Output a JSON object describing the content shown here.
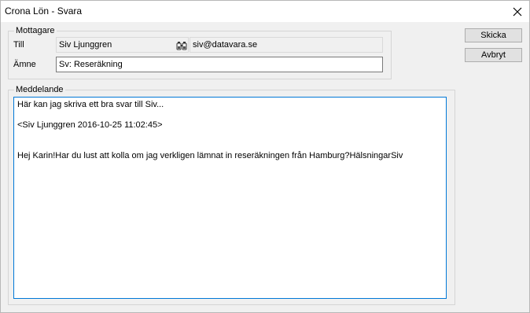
{
  "window": {
    "title": "Crona Lön - Svara"
  },
  "recipients": {
    "legend": "Mottagare",
    "to_label": "Till",
    "to_name": "Siv Ljunggren",
    "to_email": "siv@datavara.se",
    "subject_label": "Ämne",
    "subject_value": "Sv: Reseräkning"
  },
  "message": {
    "legend": "Meddelande",
    "lines": [
      "Här kan jag skriva ett bra svar till Siv...",
      "",
      "<Siv Ljunggren 2016-10-25 11:02:45>",
      "",
      "",
      "Hej Karin!Har du lust att kolla om jag verkligen lämnat in reseräkningen från Hamburg?HälsningarSiv"
    ]
  },
  "buttons": {
    "send": "Skicka",
    "cancel": "Avbryt"
  },
  "icons": {
    "close": "close-icon",
    "browse": "binoculars-icon"
  }
}
